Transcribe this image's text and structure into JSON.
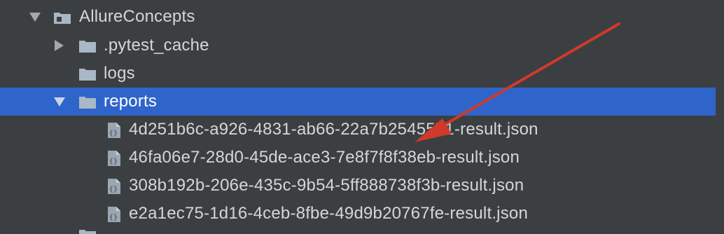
{
  "tree": {
    "root": {
      "label": "AllureConcepts",
      "expanded": true
    },
    "children": [
      {
        "label": ".pytest_cache",
        "kind": "folder",
        "expanded": false
      },
      {
        "label": "logs",
        "kind": "folder",
        "expanded": null
      },
      {
        "label": "reports",
        "kind": "folder",
        "expanded": true,
        "selected": true
      }
    ],
    "report_files": [
      "4d251b6c-a926-4831-ab66-22a7b2545571-result.json",
      "46fa06e7-28d0-45de-ace3-7e8f7f8f38eb-result.json",
      "308b192b-206e-435c-9b54-5ff888738f3b-result.json",
      "e2a1ec75-1d16-4ceb-8fbe-49d9b20767fe-result.json"
    ]
  },
  "colors": {
    "background": "#3c3f41",
    "selection": "#2f65ca",
    "text": "#d6d6d6",
    "folder_icon": "#a9b7c6",
    "annotation_arrow": "#d0392b"
  },
  "icons": {
    "expand_arrow": "chevron-down-icon",
    "collapse_arrow": "chevron-right-icon",
    "folder": "folder-icon",
    "module_folder": "module-folder-icon",
    "json_file": "json-file-icon"
  }
}
